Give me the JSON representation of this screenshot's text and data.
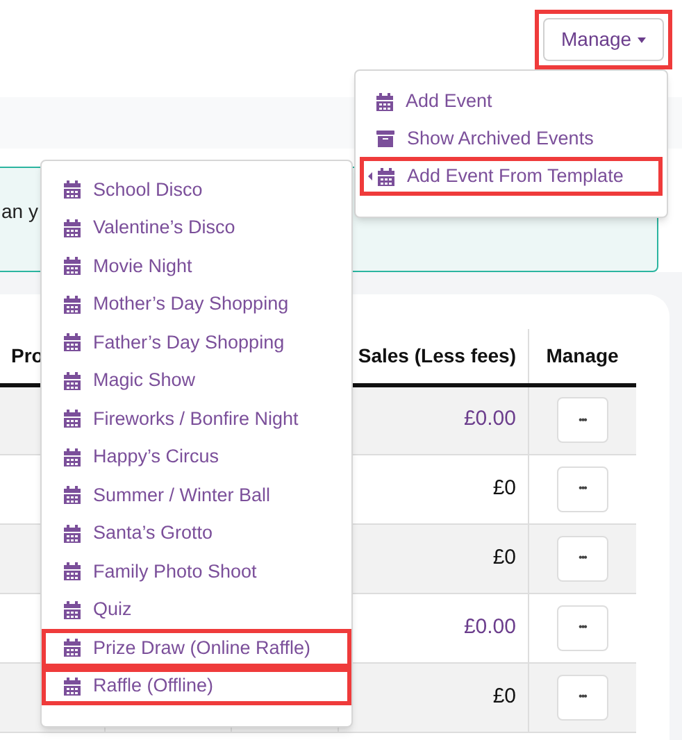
{
  "manage_button": {
    "label": "Manage",
    "highlighted": true
  },
  "alert": {
    "text": "an y"
  },
  "manage_menu": [
    {
      "label": "Add Event",
      "kind": "event",
      "submenu": false,
      "highlighted": false
    },
    {
      "label": "Show Archived Events",
      "kind": "archive",
      "submenu": false,
      "highlighted": false
    },
    {
      "label": "Add Event From Template",
      "kind": "event",
      "submenu": true,
      "highlighted": true
    }
  ],
  "template_menu": [
    {
      "label": "School Disco",
      "highlighted": false
    },
    {
      "label": "Valentine’s Disco",
      "highlighted": false
    },
    {
      "label": "Movie Night",
      "highlighted": false
    },
    {
      "label": "Mother’s Day Shopping",
      "highlighted": false
    },
    {
      "label": "Father’s Day Shopping",
      "highlighted": false
    },
    {
      "label": "Magic Show",
      "highlighted": false
    },
    {
      "label": "Fireworks / Bonfire Night",
      "highlighted": false
    },
    {
      "label": "Happy’s Circus",
      "highlighted": false
    },
    {
      "label": "Summer / Winter Ball",
      "highlighted": false
    },
    {
      "label": "Santa’s Grotto",
      "highlighted": false
    },
    {
      "label": "Family Photo Shoot",
      "highlighted": false
    },
    {
      "label": "Quiz",
      "highlighted": false
    },
    {
      "label": "Prize Draw (Online Raffle)",
      "highlighted": true
    },
    {
      "label": "Raffle (Offline)",
      "highlighted": true
    }
  ],
  "table": {
    "columns": [
      "Pro",
      "Sales (Less fees)",
      "Manage"
    ],
    "rows": [
      {
        "sales": "£0.00",
        "link": true,
        "action": "•••"
      },
      {
        "sales": "£0",
        "link": false,
        "action": "•••"
      },
      {
        "sales": "£0",
        "link": false,
        "action": "•••"
      },
      {
        "sales": "£0.00",
        "link": true,
        "action": "•••"
      },
      {
        "sales": "£0",
        "link": false,
        "action": "•••"
      }
    ]
  }
}
